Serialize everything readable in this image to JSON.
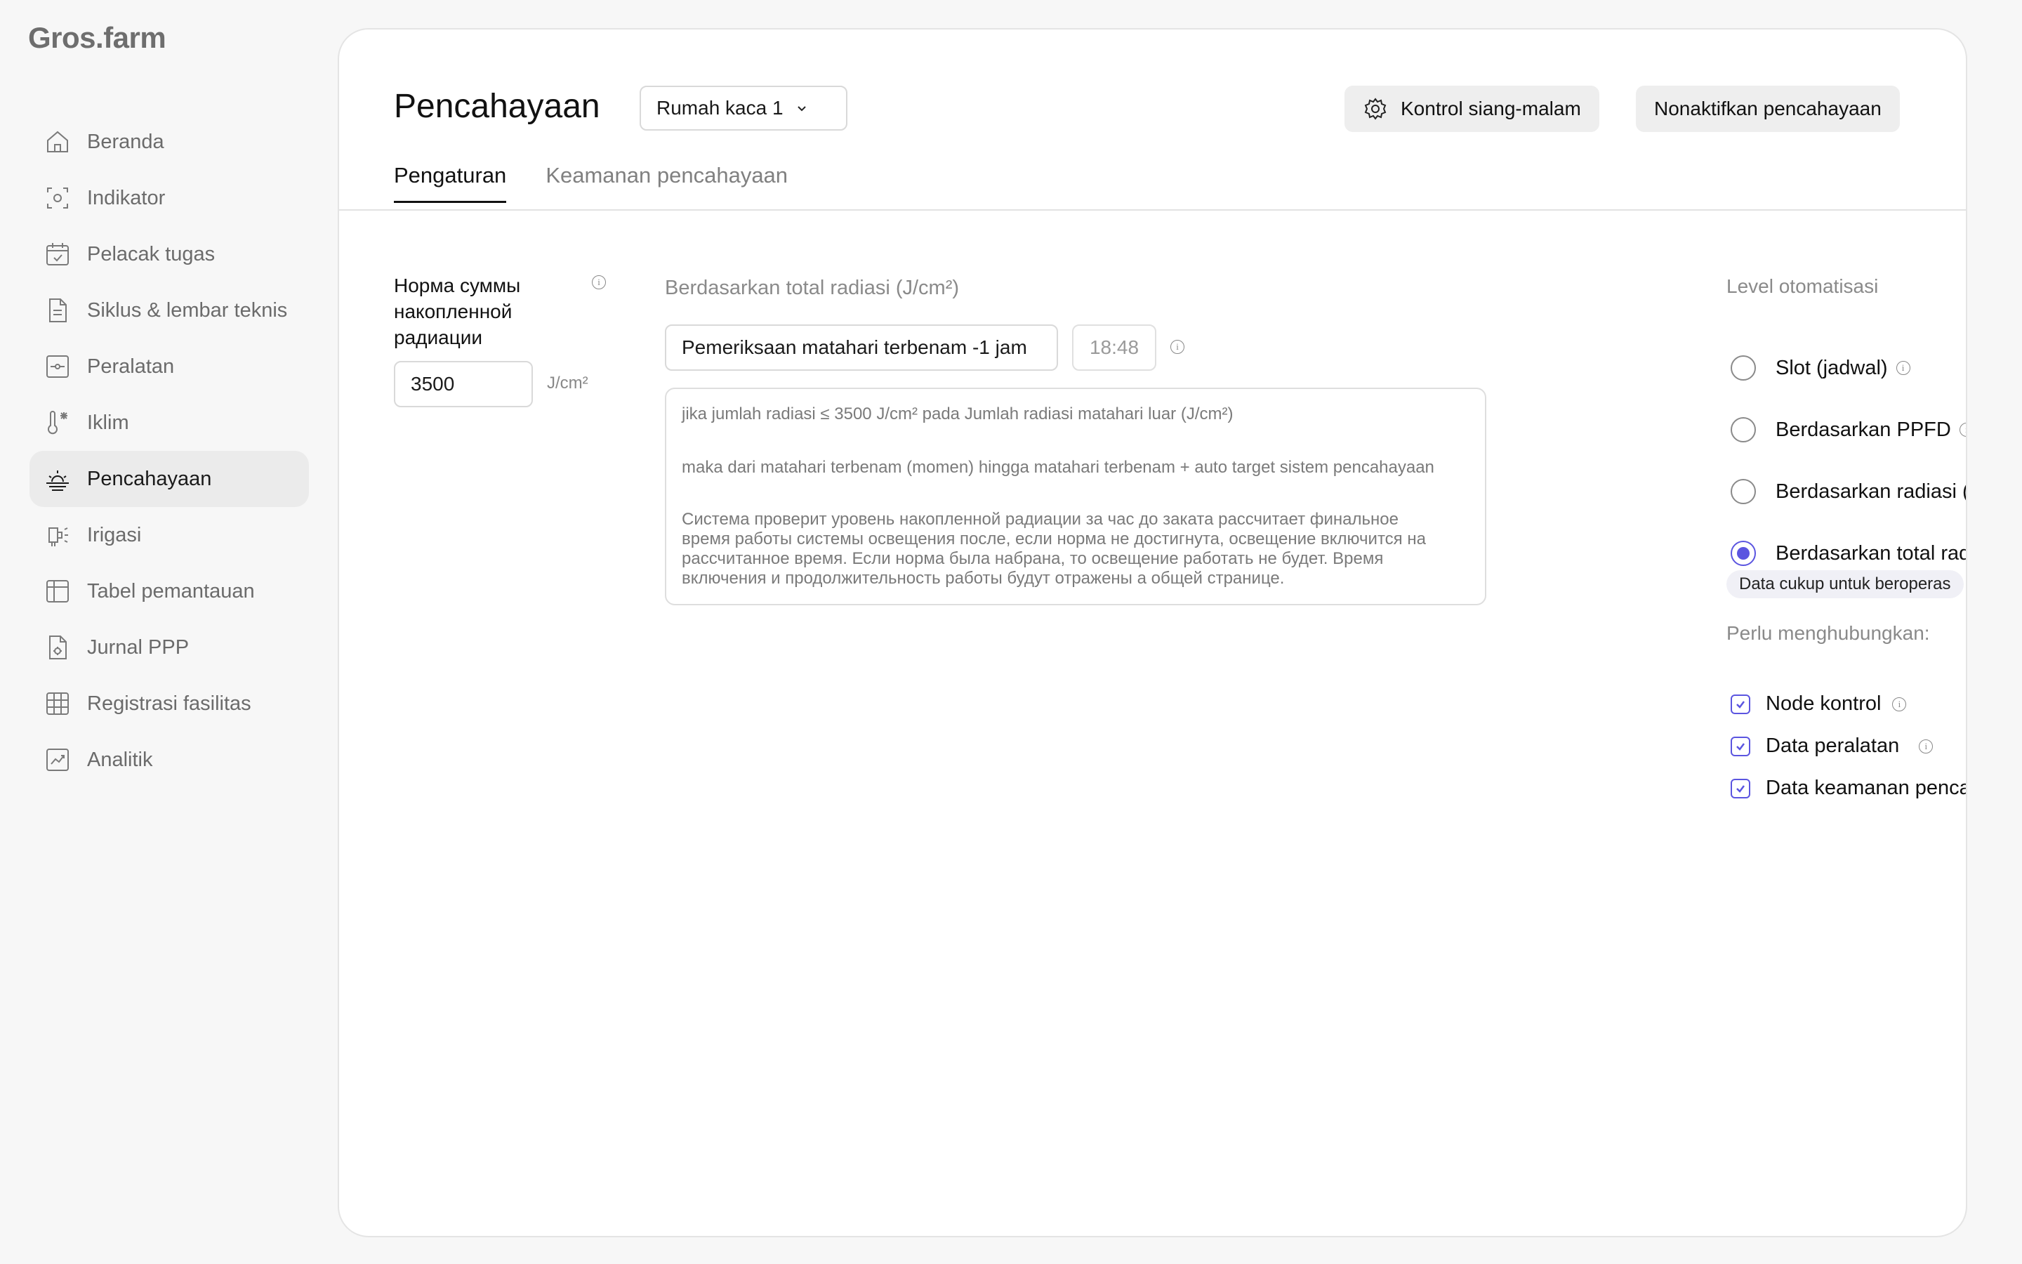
{
  "app": {
    "logo": "Gros.farm"
  },
  "sidebar": {
    "items": [
      {
        "label": "Beranda",
        "icon": "home-icon",
        "active": false
      },
      {
        "label": "Indikator",
        "icon": "sensor-icon",
        "active": false
      },
      {
        "label": "Pelacak tugas",
        "icon": "calendar-check-icon",
        "active": false
      },
      {
        "label": "Siklus & lembar teknis",
        "icon": "document-icon",
        "active": false
      },
      {
        "label": "Peralatan",
        "icon": "equipment-icon",
        "active": false
      },
      {
        "label": "Iklim",
        "icon": "thermometer-icon",
        "active": false
      },
      {
        "label": "Pencahayaan",
        "icon": "sunrise-icon",
        "active": true
      },
      {
        "label": "Irigasi",
        "icon": "sprinkler-icon",
        "active": false
      },
      {
        "label": "Tabel pemantauan",
        "icon": "table-icon",
        "active": false
      },
      {
        "label": "Jurnal PPP",
        "icon": "journal-icon",
        "active": false
      },
      {
        "label": "Registrasi fasilitas",
        "icon": "grid-icon",
        "active": false
      },
      {
        "label": "Analitik",
        "icon": "chart-icon",
        "active": false
      }
    ]
  },
  "header": {
    "title": "Pencahayaan",
    "greenhouse_select": "Rumah kaca 1",
    "day_night_button": "Kontrol siang-malam",
    "disable_button": "Nonaktifkan pencahayaan"
  },
  "tabs": [
    {
      "label": "Pengaturan",
      "active": true
    },
    {
      "label": "Keamanan pencahayaan",
      "active": false
    }
  ],
  "norm": {
    "label": "Норма суммы накопленной радиации",
    "value": "3500",
    "unit": "J/cm²"
  },
  "basis": {
    "title": "Berdasarkan total radiasi (J/cm²)",
    "check_select": "Pemeriksaan matahari terbenam -1 jam",
    "time": "18:48",
    "rule_line1": "jika jumlah radiasi ≤ 3500 J/cm² pada Jumlah radiasi matahari luar (J/cm²)",
    "rule_line2": "maka dari matahari terbenam (momen) hingga matahari terbenam + auto target sistem pencahayaan",
    "rule_description": "Система проверит  уровень накопленной радиации за час до заката рассчитает финальное время работы системы освещения после, если норма не достигнута, освещение включится на рассчитанное время. Если норма была набрана, то освещение работать не будет. Время включения и продолжительность работы будут отражены а общей странице."
  },
  "automation": {
    "title": "Level otomatisasi",
    "options": [
      {
        "label": "Slot (jadwal)",
        "selected": false,
        "info": true
      },
      {
        "label": "Berdasarkan PPFD",
        "selected": false,
        "info": true
      },
      {
        "label": "Berdasarkan radiasi (",
        "selected": false,
        "info": false
      },
      {
        "label": "Berdasarkan total rad",
        "selected": true,
        "info": false
      }
    ],
    "badge": "Data cukup untuk beroperas",
    "need_title": "Perlu menghubungkan:",
    "requirements": [
      {
        "label": "Node kontrol",
        "checked": true,
        "info": true
      },
      {
        "label": "Data peralatan",
        "checked": true,
        "info": true
      },
      {
        "label": "Data keamanan penca",
        "checked": true,
        "info": false
      }
    ]
  },
  "colors": {
    "accent": "#5b55e0",
    "active_nav_bg": "#ebebeb"
  }
}
